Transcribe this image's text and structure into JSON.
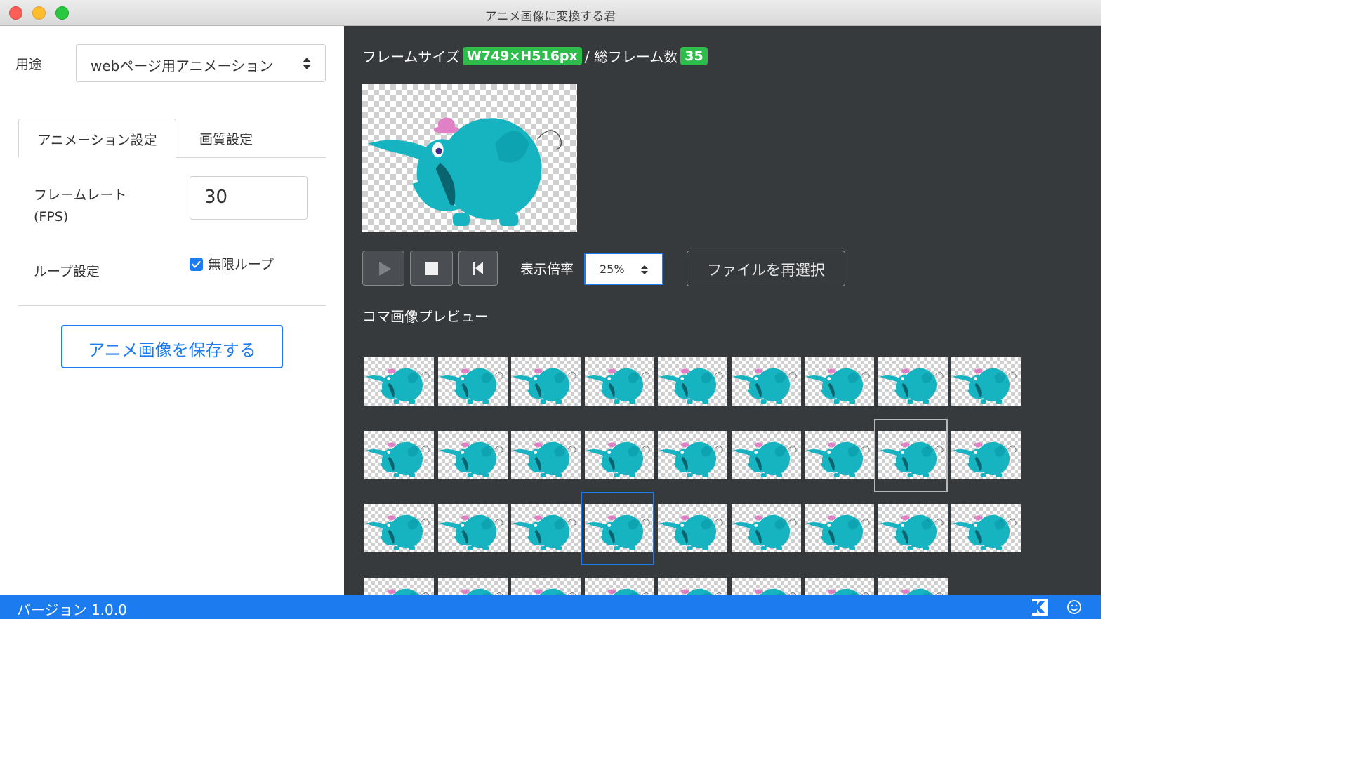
{
  "window": {
    "title": "アニメ画像に変換する君"
  },
  "left": {
    "purpose_label": "用途",
    "purpose_value": "webページ用アニメーション",
    "tabs": [
      {
        "label": "アニメーション設定",
        "active": true
      },
      {
        "label": "画質設定",
        "active": false
      }
    ],
    "frame_rate_label_1": "フレームレート",
    "frame_rate_label_2": "(FPS)",
    "frame_rate_value": "30",
    "loop_label": "ループ設定",
    "loop_checkbox_label": "無限ループ",
    "loop_checked": true,
    "save_button": "アニメ画像を保存する"
  },
  "right": {
    "frame_size_label": "フレームサイズ",
    "frame_size_value": "W749×H516px",
    "total_frames_label": "/ 総フレーム数",
    "total_frames_value": "35",
    "zoom_label": "表示倍率",
    "zoom_value": "25%",
    "reselect_button": "ファイルを再選択",
    "section_title": "コマ画像プレビュー",
    "thumbnail_count": 35,
    "selected_frame": 21,
    "hovered_frame": 16
  },
  "status": {
    "version": "バージョン 1.0.0"
  },
  "icons": [
    "play-icon",
    "stop-icon",
    "skip-back-icon",
    "logo-icon",
    "smile-icon",
    "select-arrows-icon"
  ],
  "colors": {
    "accent": "#1d7bf0",
    "badge": "#2ebd4b",
    "dark_panel": "#363a3d",
    "elephant": "#16b3c0"
  }
}
